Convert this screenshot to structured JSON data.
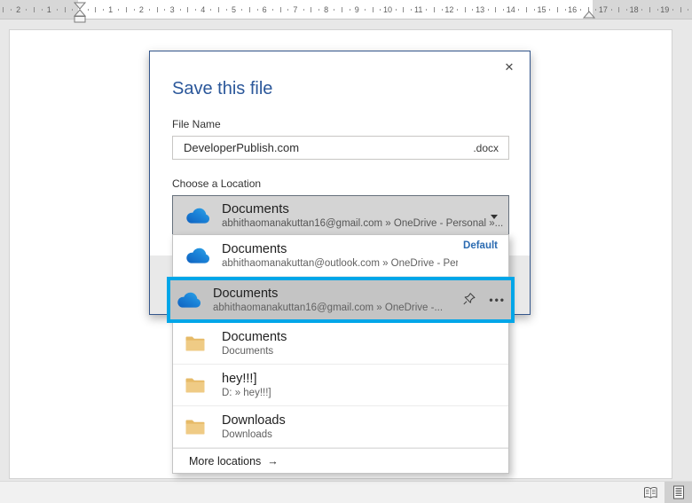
{
  "ruler": {
    "left_numbers": [
      "2",
      "1"
    ],
    "main_numbers": [
      "1",
      "2",
      "3",
      "4",
      "5",
      "6",
      "7",
      "8",
      "9",
      "10",
      "11",
      "12",
      "13",
      "14",
      "15",
      "16"
    ],
    "right_numbers": [
      "17",
      "18",
      "19"
    ]
  },
  "dialog": {
    "title": "Save this file",
    "close_glyph": "✕",
    "file_name": {
      "label": "File Name",
      "value": "DeveloperPublish.com",
      "extension": ".docx"
    },
    "location": {
      "label": "Choose a Location",
      "selected": {
        "title": "Documents",
        "subtitle": "abhithaomanakuttan16@gmail.com » OneDrive - Personal »..."
      },
      "items": [
        {
          "title": "Documents",
          "subtitle": "abhithaomanakuttan@outlook.com » OneDrive - Personal » Do...",
          "badge": "Default",
          "icon": "onedrive-cloud-icon"
        },
        {
          "title": "Documents",
          "subtitle": "abhithaomanakuttan16@gmail.com » OneDrive -...",
          "icon": "onedrive-cloud-icon",
          "highlighted": true
        },
        {
          "title": "Documents",
          "subtitle": "Documents",
          "icon": "folder-icon"
        },
        {
          "title": "hey!!!]",
          "subtitle": "D: » hey!!!]",
          "icon": "folder-icon"
        },
        {
          "title": "Downloads",
          "subtitle": "Downloads",
          "icon": "folder-icon"
        }
      ],
      "footer": {
        "label": "More locations",
        "arrow": "→"
      },
      "ellipsis_glyph": "•••"
    }
  },
  "status_bar": {
    "view_buttons": [
      {
        "name": "read-mode",
        "selected": false
      },
      {
        "name": "print-layout",
        "selected": true
      }
    ]
  },
  "colors": {
    "dialog_border": "#34568b",
    "title_blue": "#2b579a",
    "highlight_cyan": "#00a6e8",
    "highlight_row_bg": "#c4c4c4",
    "default_badge_blue": "#2b6bb1",
    "folder_tan": "#ecc679",
    "onedrive_blue_dark": "#0f62c0",
    "onedrive_blue_light": "#31a7e8",
    "select_bg": "#d4d4d4"
  }
}
